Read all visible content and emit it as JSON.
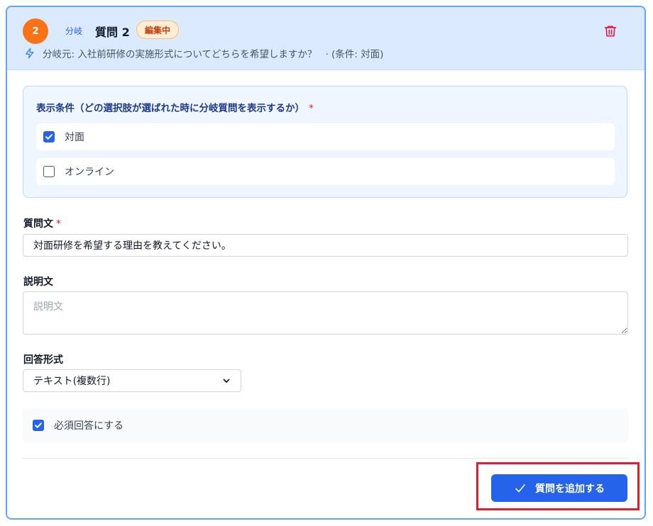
{
  "header": {
    "number": "2",
    "branch_tag": "分岐",
    "title": "質問 2",
    "status_badge": "編集中",
    "source_label": "分岐元: 入社前研修の実施形式についてどちらを希望しますか？",
    "source_condition": "· (条件: 対面)",
    "icons": {
      "delete": "trash-icon",
      "branch": "lightning-icon"
    }
  },
  "conditions": {
    "title": "表示条件（どの選択肢が選ばれた時に分岐質問を表示するか）",
    "required_mark": "*",
    "options": [
      {
        "label": "対面",
        "checked": true
      },
      {
        "label": "オンライン",
        "checked": false
      }
    ]
  },
  "question_text": {
    "label": "質問文",
    "required_mark": "*",
    "value": "対面研修を希望する理由を教えてください。"
  },
  "description": {
    "label": "説明文",
    "placeholder": "説明文",
    "value": ""
  },
  "answer_format": {
    "label": "回答形式",
    "selected": "テキスト(複数行)"
  },
  "required_toggle": {
    "label": "必須回答にする",
    "checked": true
  },
  "submit": {
    "label": "質問を追加する",
    "icon": "check-icon"
  },
  "colors": {
    "accent": "#2563eb",
    "header_bg": "#dbeafe",
    "badge_orange": "#f97316",
    "delete_red": "#e11d48",
    "highlight_red": "#e11d2e"
  }
}
